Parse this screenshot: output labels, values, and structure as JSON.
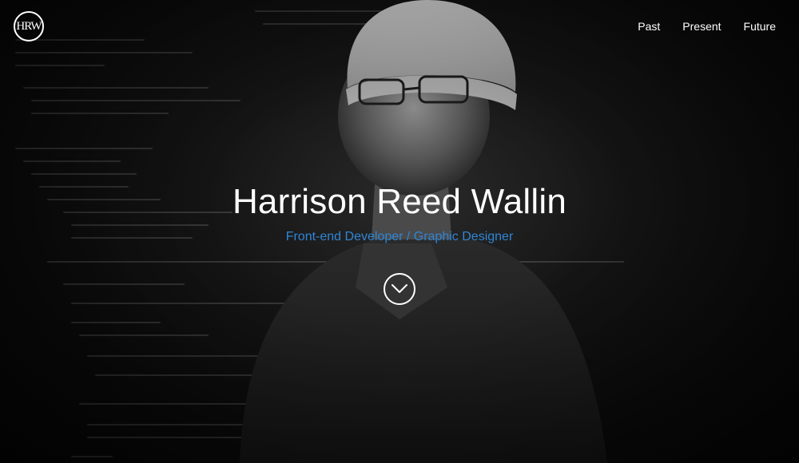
{
  "header": {
    "logo_text": "HRW",
    "nav": [
      {
        "label": "Past"
      },
      {
        "label": "Present"
      },
      {
        "label": "Future"
      }
    ]
  },
  "hero": {
    "name": "Harrison Reed Wallin",
    "tagline": "Front-end Developer / Graphic Designer",
    "scroll_icon": "chevron-down-icon"
  },
  "colors": {
    "accent": "#2f86d6",
    "text": "#ffffff",
    "background": "#0b0b0b"
  }
}
